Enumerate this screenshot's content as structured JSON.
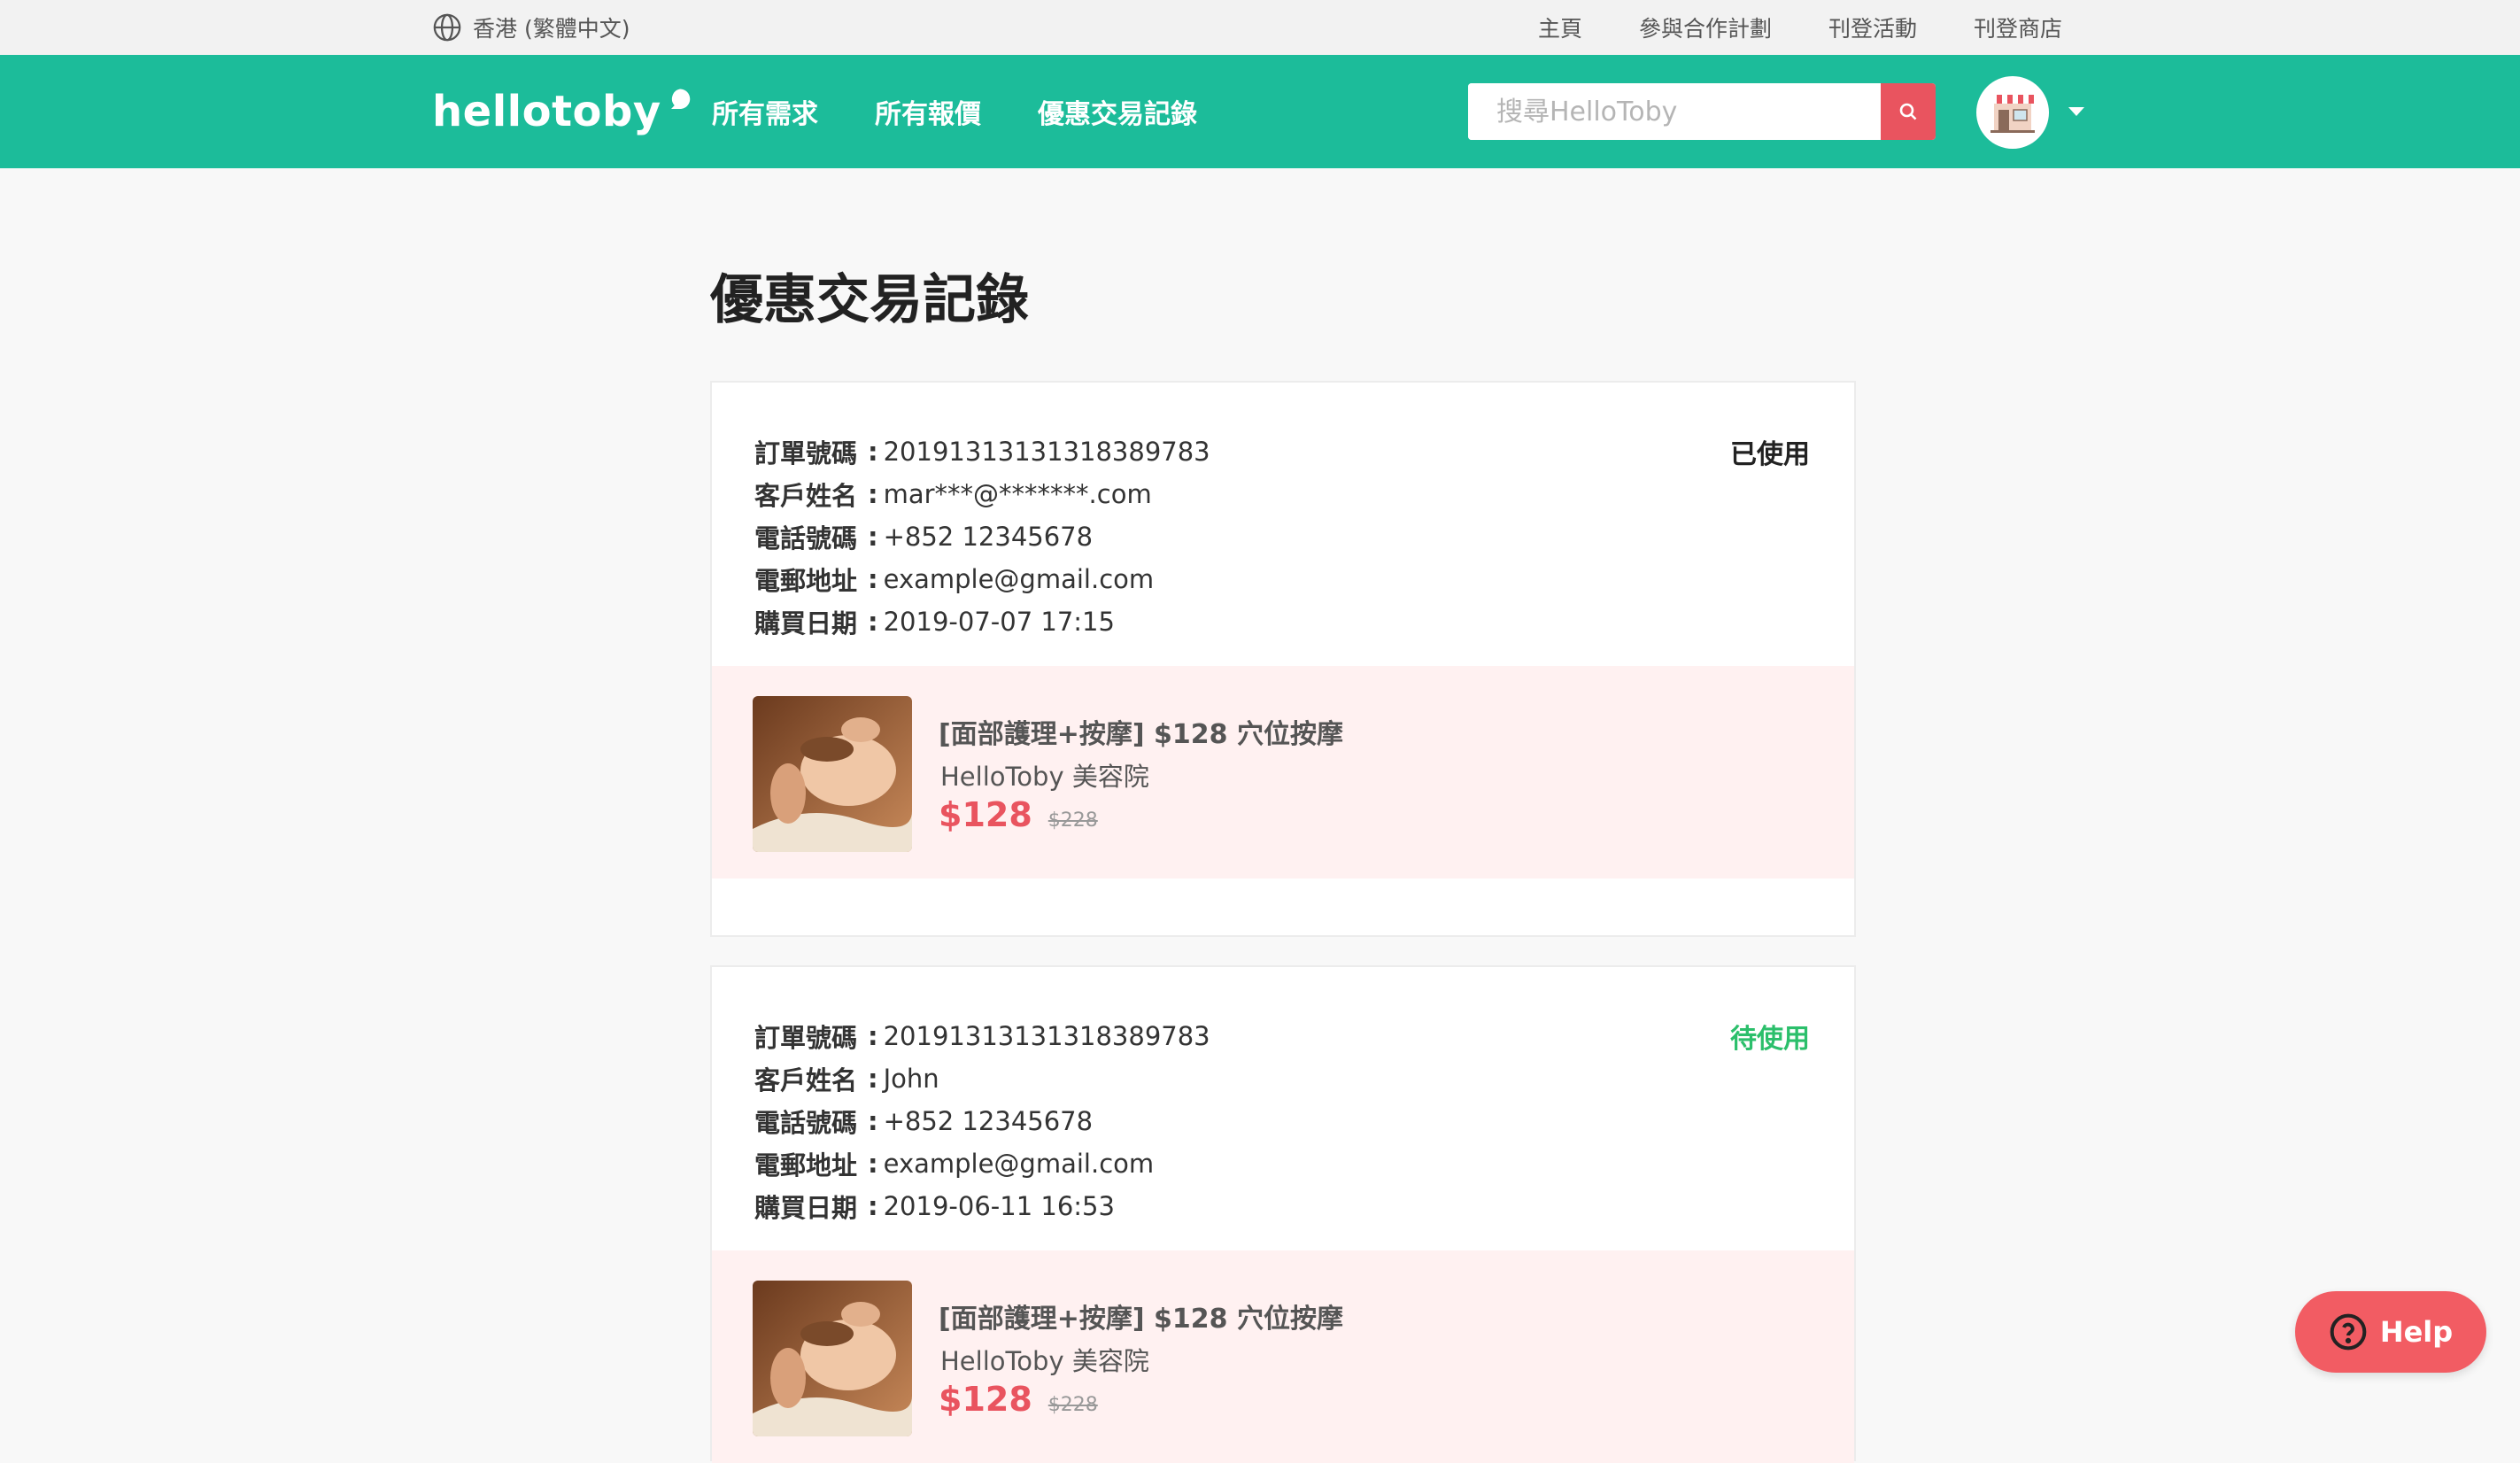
{
  "topbar": {
    "locale": "香港 (繁體中文)",
    "links": [
      "主頁",
      "參與合作計劃",
      "刊登活動",
      "刊登商店"
    ]
  },
  "header": {
    "logo": "hellotoby",
    "nav": [
      "所有需求",
      "所有報價",
      "優惠交易記錄"
    ],
    "search_placeholder": "搜尋HelloToby"
  },
  "page_title": "優惠交易記錄",
  "labels": {
    "order": "訂單號碼",
    "customer": "客戶姓名",
    "phone": "電話號碼",
    "email": "電郵地址",
    "date": "購買日期",
    "colon": ":"
  },
  "orders": [
    {
      "order_no": "20191313131318389783",
      "customer": "mar***@*******.com",
      "phone": "+852 12345678",
      "email": "example@gmail.com",
      "date": "2019-07-07 17:15",
      "status": "已使用",
      "item": {
        "title": "[面部護理+按摩] $128 穴位按摩",
        "shop": "HelloToby 美容院",
        "price": "$128",
        "original_price": "$228"
      }
    },
    {
      "order_no": "20191313131318389783",
      "customer": "John",
      "phone": "+852 12345678",
      "email": "example@gmail.com",
      "date": "2019-06-11 16:53",
      "status": "待使用",
      "item": {
        "title": "[面部護理+按摩] $128 穴位按摩",
        "shop": "HelloToby 美容院",
        "price": "$128",
        "original_price": "$228"
      }
    }
  ],
  "help_label": "Help",
  "colors": {
    "brand": "#1cbc9a",
    "accent": "#e9545f",
    "pending": "#2bbf6b",
    "item_bg": "#fff1f1"
  }
}
